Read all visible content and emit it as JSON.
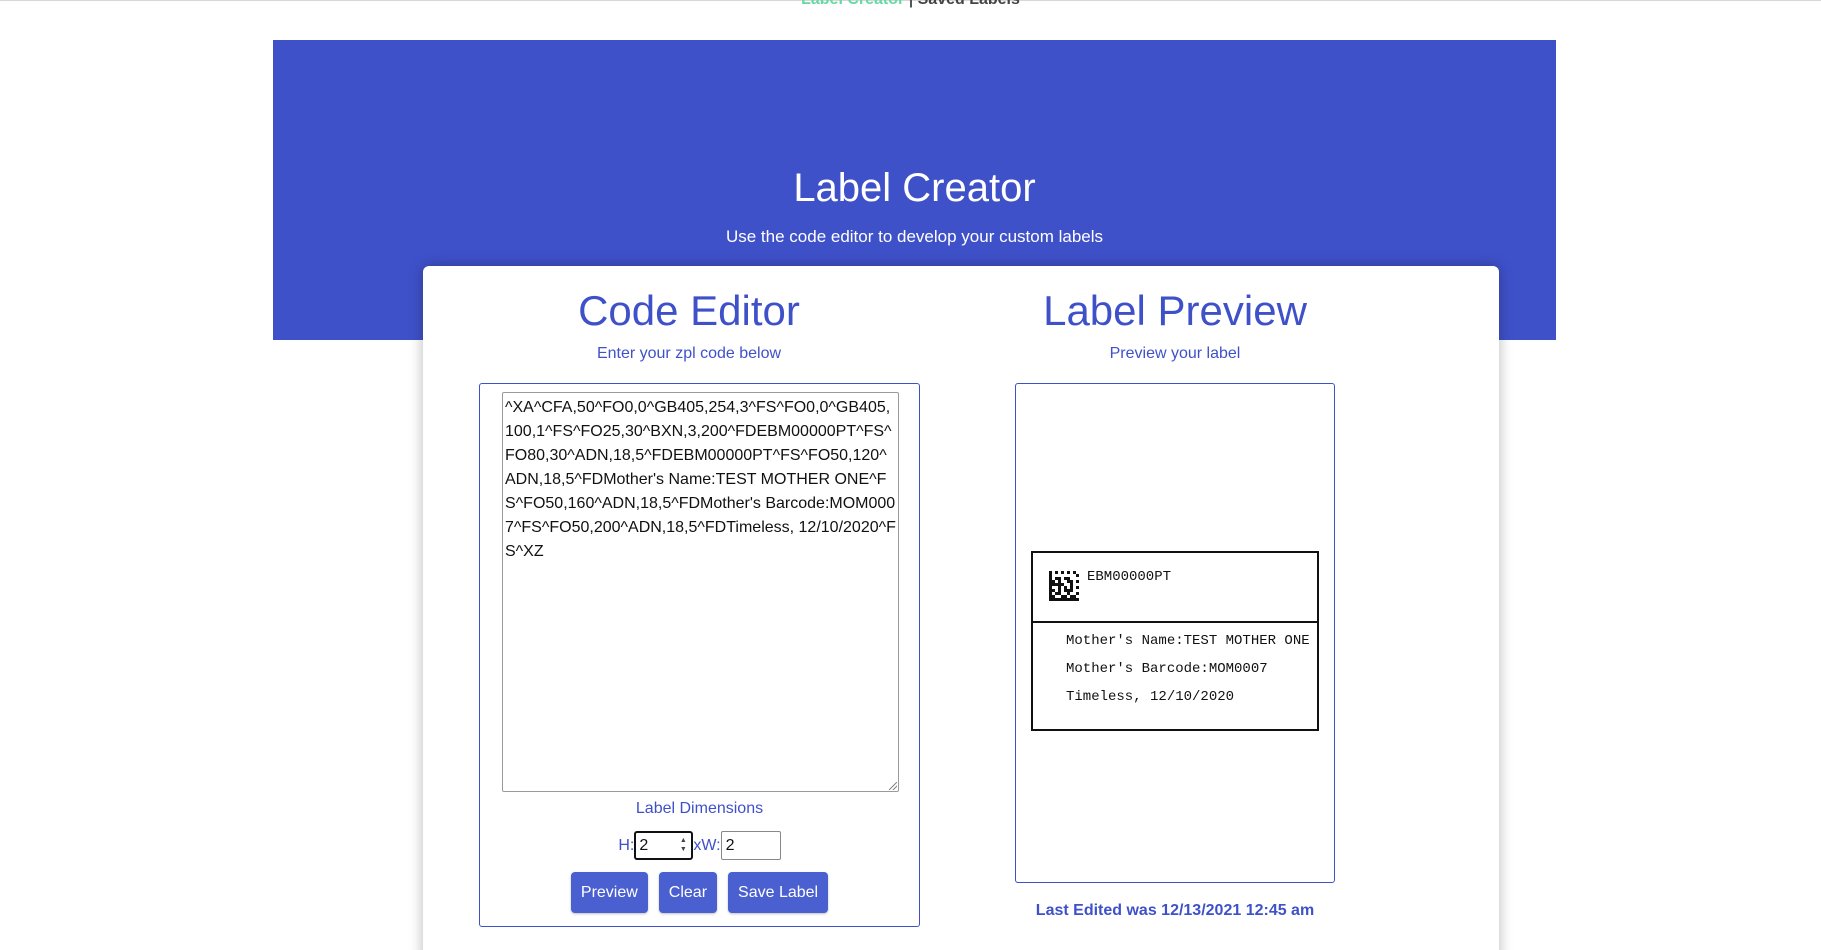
{
  "nav": {
    "active": "Label Creator",
    "separator": "|",
    "other": "Saved Labels"
  },
  "hero": {
    "title": "Label Creator",
    "subtitle": "Use the code editor to develop your custom labels",
    "color": "#3f51c9"
  },
  "editor": {
    "title": "Code Editor",
    "subtitle": "Enter your zpl code below",
    "code": "^XA^CFA,50^FO0,0^GB405,254,3^FS^FO0,0^GB405,100,1^FS^FO25,30^BXN,3,200^FDEBM00000PT^FS^FO80,30^ADN,18,5^FDEBM00000PT^FS^FO50,120^ADN,18,5^FDMother's Name:TEST MOTHER ONE^FS^FO50,160^ADN,18,5^FDMother's Barcode:MOM0007^FS^FO50,200^ADN,18,5^FDTimeless, 12/10/2020^FS^XZ",
    "dimensions_label": "Label Dimensions",
    "height_label": "H:",
    "height_value": "2",
    "width_label": "xW:",
    "width_value": "2",
    "buttons": {
      "preview": "Preview",
      "clear": "Clear",
      "save": "Save Label"
    }
  },
  "preview": {
    "title": "Label Preview",
    "subtitle": "Preview your label",
    "label": {
      "code": "EBM00000PT",
      "barcode_icon": "datamatrix-icon",
      "lines": [
        "Mother's Name:TEST MOTHER ONE",
        "Mother's Barcode:MOM0007",
        "Timeless, 12/10/2020"
      ]
    },
    "last_edited": "Last Edited was 12/13/2021 12:45 am"
  }
}
